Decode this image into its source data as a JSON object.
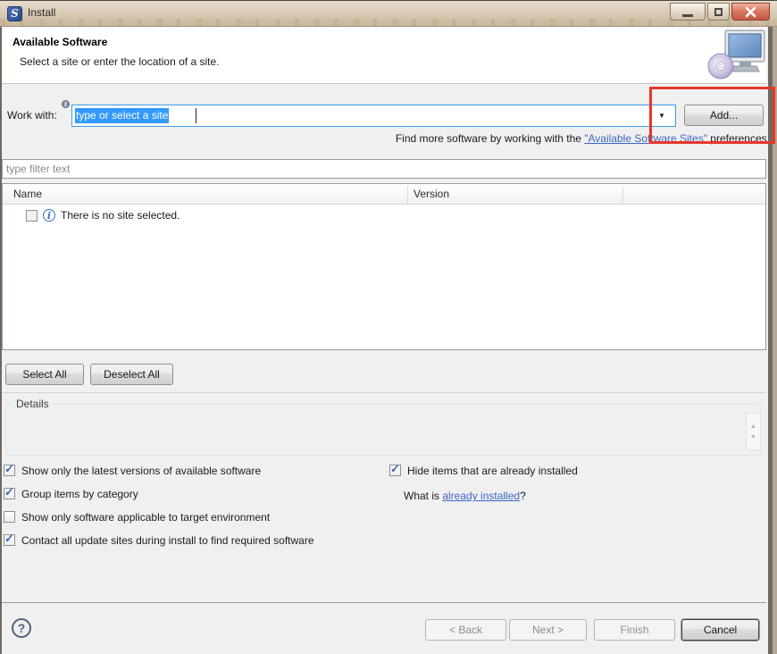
{
  "window": {
    "title": "Install"
  },
  "icons": {
    "app": "S",
    "info_superscript": "i",
    "info_row": "i",
    "dropdown": "▼",
    "scroll_up": "▲",
    "scroll_down": "▼",
    "help": "?"
  },
  "header": {
    "title": "Available Software",
    "subtitle": "Select a site or enter the location of a site."
  },
  "work_with": {
    "label": "Work with:",
    "value": "type or select a site",
    "add": "Add..."
  },
  "find_more": {
    "prefix": "Find more software by working with the ",
    "link": "\"Available Software Sites\"",
    "suffix": " preferences."
  },
  "filter": {
    "placeholder": "type filter text"
  },
  "table": {
    "name_col": "Name",
    "version_col": "Version",
    "row_text": "There is no site selected.",
    "row_checked": false
  },
  "buttons": {
    "select_all": "Select All",
    "deselect_all": "Deselect All",
    "back": "< Back",
    "next": "Next >",
    "finish": "Finish",
    "cancel": "Cancel"
  },
  "details": {
    "label": "Details"
  },
  "options": {
    "left": [
      {
        "label": "Show only the latest versions of available software",
        "checked": true
      },
      {
        "label": "Group items by category",
        "checked": true
      },
      {
        "label": "Show only software applicable to target environment",
        "checked": false
      },
      {
        "label": "Contact all update sites during install to find required software",
        "checked": true
      }
    ],
    "right": [
      {
        "label": "Hide items that are already installed",
        "checked": true
      }
    ],
    "what_is_prefix": "What is ",
    "what_is_link": "already installed",
    "what_is_suffix": "?"
  },
  "colors": {
    "annotation_red": "#e7372b",
    "selection_blue": "#3399ff",
    "link_blue": "#3b66c4",
    "titlebar_tan": "#d8c8b2"
  }
}
